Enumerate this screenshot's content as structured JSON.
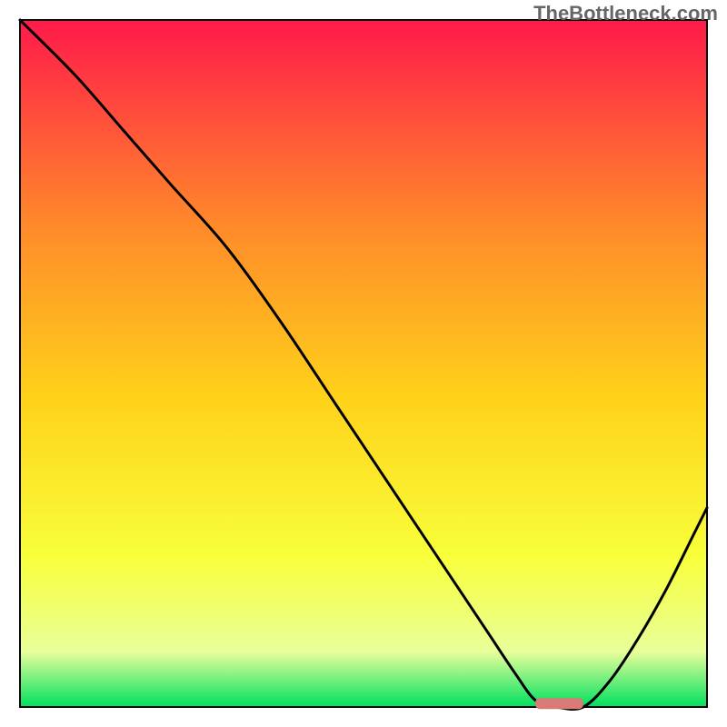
{
  "watermark": "TheBottleneck.com",
  "colors": {
    "gradient_top": "#ff1a4a",
    "gradient_mid_upper": "#ff8a2a",
    "gradient_mid": "#ffd21a",
    "gradient_mid_lower": "#f8ff3a",
    "gradient_near_bottom": "#e8ff9a",
    "gradient_bottom": "#00e060",
    "curve": "#000000",
    "marker_fill": "#d87a78",
    "frame": "#000000"
  },
  "chart_data": {
    "type": "line",
    "title": "",
    "xlabel": "",
    "ylabel": "",
    "xlim": [
      0,
      100
    ],
    "ylim": [
      0,
      100
    ],
    "series": [
      {
        "name": "bottleneck-curve",
        "x": [
          0,
          8,
          15,
          22,
          30,
          38,
          46,
          54,
          62,
          68,
          72,
          75,
          78,
          82,
          86,
          90,
          94,
          98,
          100
        ],
        "values": [
          100,
          92,
          84,
          76,
          67,
          56,
          44,
          32,
          20,
          11,
          5,
          1,
          0,
          0,
          4,
          10,
          17,
          25,
          29
        ]
      }
    ],
    "marker": {
      "x_start": 75,
      "x_end": 82,
      "y": 0.5
    }
  }
}
